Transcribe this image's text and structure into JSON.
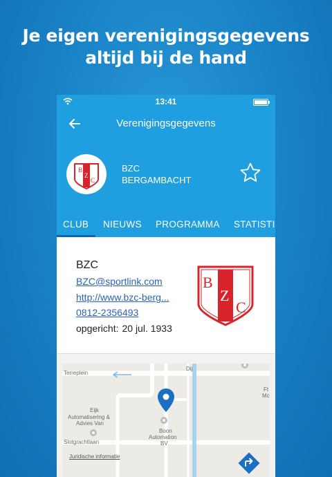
{
  "headline": {
    "line1": "Je eigen verenigingsgegevens",
    "line2": "altijd bij de hand"
  },
  "status_bar": {
    "time": "13:41"
  },
  "app_bar": {
    "title": "Verenigingsgegevens"
  },
  "club_header": {
    "name_line1": "BZC",
    "name_line2": "BERGAMBACHT",
    "logo_letters": [
      "B",
      "Z",
      "C"
    ]
  },
  "tabs": [
    {
      "label": "CLUB",
      "active": true
    },
    {
      "label": "NIEUWS",
      "active": false
    },
    {
      "label": "PROGRAMMA",
      "active": false
    },
    {
      "label": "STATISTI",
      "active": false
    }
  ],
  "club_card": {
    "name": "BZC",
    "email": "BZC@sportlink.com",
    "website": "http://www.bzc-berg...",
    "phone": "0812-2356493",
    "founded_label": "opgericht:",
    "founded_date": "20 jul. 1933"
  },
  "map": {
    "labels": {
      "terreplein": "Terreplein",
      "dijk": "Dij",
      "eijk1": "Eijk",
      "eijk2": "Automatisering &",
      "eijk3": "Advies Van",
      "slotgracht": "Slotgrachtlaan",
      "boon1": "Boon",
      "boon2": "Automation",
      "boon3": "BV",
      "ft1": "Ft",
      "ft2": "Mc"
    },
    "legal": "Juridische informatie"
  },
  "colors": {
    "primary": "#1f9ee0",
    "tab_indicator": "#1166a8",
    "link": "#2a62b8",
    "club_red": "#d8232a",
    "map_pin": "#1a6fc4"
  },
  "icons": [
    "wifi-icon",
    "battery-icon",
    "back-arrow-icon",
    "star-outline-icon",
    "club-logo-shield",
    "map-pin-icon",
    "directions-icon"
  ]
}
